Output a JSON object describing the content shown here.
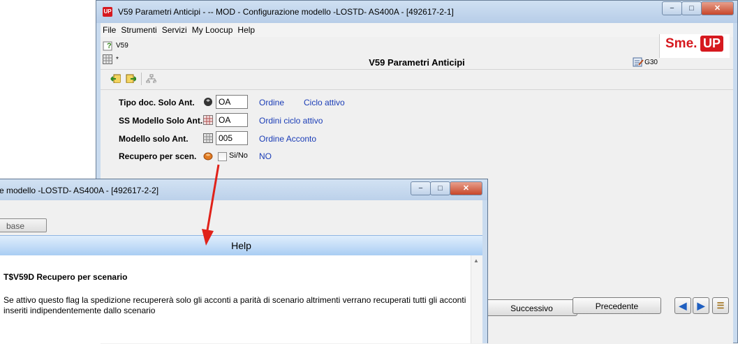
{
  "main_window": {
    "app_icon": "UP",
    "title": "V59 Parametri Anticipi -  -- MOD - Configurazione modello -LOSTD- AS400A - [492617-2-1]",
    "buttons": {
      "minimize": "−",
      "maximize": "□",
      "close": "✕"
    },
    "menu": [
      {
        "label": "File"
      },
      {
        "label": "Strumenti"
      },
      {
        "label": "Servizi"
      },
      {
        "label": "My Loocup"
      },
      {
        "label": "Help"
      }
    ],
    "header": {
      "code": "V59",
      "marker": "*",
      "page_title": "V59 Parametri Anticipi",
      "right_code": "G30",
      "logo_left": "Sme.",
      "logo_right": "UP"
    },
    "fields": [
      {
        "label": "Tipo doc. Solo Ant.",
        "value": "OA",
        "desc1": "Ordine",
        "desc2": "Ciclo attivo",
        "icon": "cube-icon"
      },
      {
        "label": "SS Modello Solo Ant.",
        "value": "OA",
        "desc1": "Ordini ciclo attivo",
        "icon": "table-icon"
      },
      {
        "label": "Modello solo Ant.",
        "value": "005",
        "desc1": "Ordine Acconto",
        "icon": "grid-icon"
      },
      {
        "label": "Recupero per scen.",
        "check_label": "Si/No",
        "desc1": "NO",
        "icon": "orange-circle-icon"
      }
    ],
    "bottom": {
      "next": "Successivo",
      "prev": "Precedente"
    }
  },
  "help_window": {
    "title": "e modello -LOSTD- AS400A - [492617-2-2]",
    "tab": "base",
    "band": "Help",
    "heading": "T$V59D Recupero per scenario",
    "text": "Se attivo questo flag la spedizione recupererà solo gli acconti a parità di scenario altrimenti verrano recuperati tutti gli acconti inseriti indipendentemente dallo scenario"
  },
  "colors": {
    "accent": "#d6191f",
    "link": "#1a3cb6",
    "arrow": "#e0221a"
  }
}
